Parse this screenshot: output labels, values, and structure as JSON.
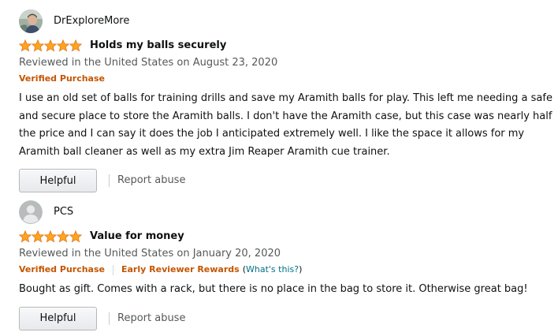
{
  "reviews": [
    {
      "profile_name": "DrExploreMore",
      "avatar_kind": "photo",
      "rating": 5,
      "star_color": "#ffa41c",
      "title": "Holds my balls securely",
      "date_text": "Reviewed in the United States on August 23, 2020",
      "badges": {
        "verified": "Verified Purchase"
      },
      "body": "I use an old set of balls for training drills and save my Aramith balls for play. This left me needing a safe and secure place to store the Aramith balls. I don't have the Aramith case, but this case was nearly half the price and I can say it does the job I anticipated extremely well. I like the space it allows for my Aramith ball cleaner as well as my extra Jim Reaper Aramith cue trainer.",
      "helpful_label": "Helpful",
      "report_label": "Report abuse"
    },
    {
      "profile_name": "PCS",
      "avatar_kind": "default-user-icon",
      "rating": 5,
      "star_color": "#ffa41c",
      "title": "Value for money",
      "date_text": "Reviewed in the United States on January 20, 2020",
      "badges": {
        "verified": "Verified Purchase",
        "early_reviewer": "Early Reviewer Rewards",
        "whats_this_open": "(",
        "whats_this_link": "What's this?",
        "whats_this_close": ")"
      },
      "body": "Bought as gift. Comes with a rack, but there is no place in the bag to store it. Otherwise great bag!",
      "helpful_label": "Helpful",
      "report_label": "Report abuse"
    }
  ]
}
